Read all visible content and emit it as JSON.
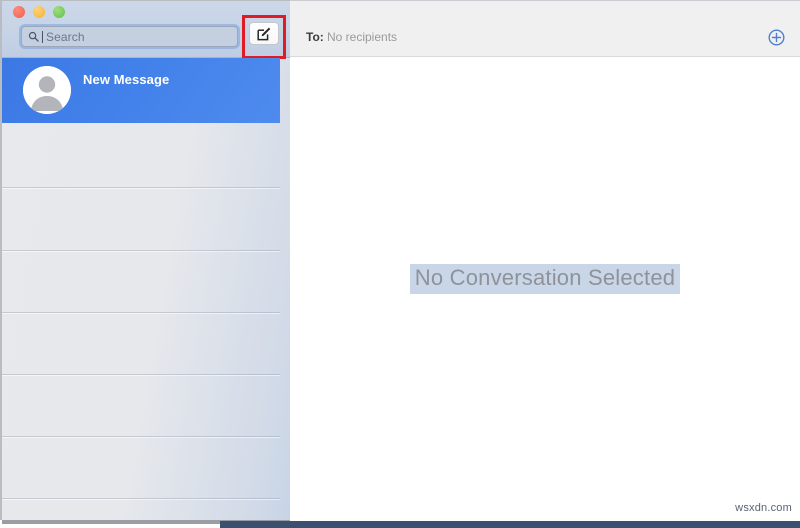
{
  "window": {
    "traffic_lights": [
      {
        "name": "close",
        "color": "#ef5f4c"
      },
      {
        "name": "minimize",
        "color": "#f2b134"
      },
      {
        "name": "zoom",
        "color": "#5fc04a"
      }
    ]
  },
  "sidebar": {
    "search": {
      "placeholder": "Search",
      "value": "",
      "icon": "search-icon"
    },
    "compose": {
      "label": "",
      "icon": "compose-icon",
      "highlight_color": "#e01b24"
    },
    "conversations": [
      {
        "title": "New Message",
        "selected": true,
        "avatar_icon": "person-placeholder-icon",
        "accent": "#4281ea"
      }
    ],
    "empty_row_separators": [
      186,
      249,
      311,
      373,
      435,
      497
    ]
  },
  "detail": {
    "to_label": "To:",
    "recipients": "No recipients",
    "add_recipient_icon": "plus-circle-icon",
    "add_recipient_color": "#4e7fd4",
    "empty_state": "No Conversation Selected",
    "empty_state_highlight": "#c9d6e8"
  },
  "watermark": "wsxdn.com"
}
